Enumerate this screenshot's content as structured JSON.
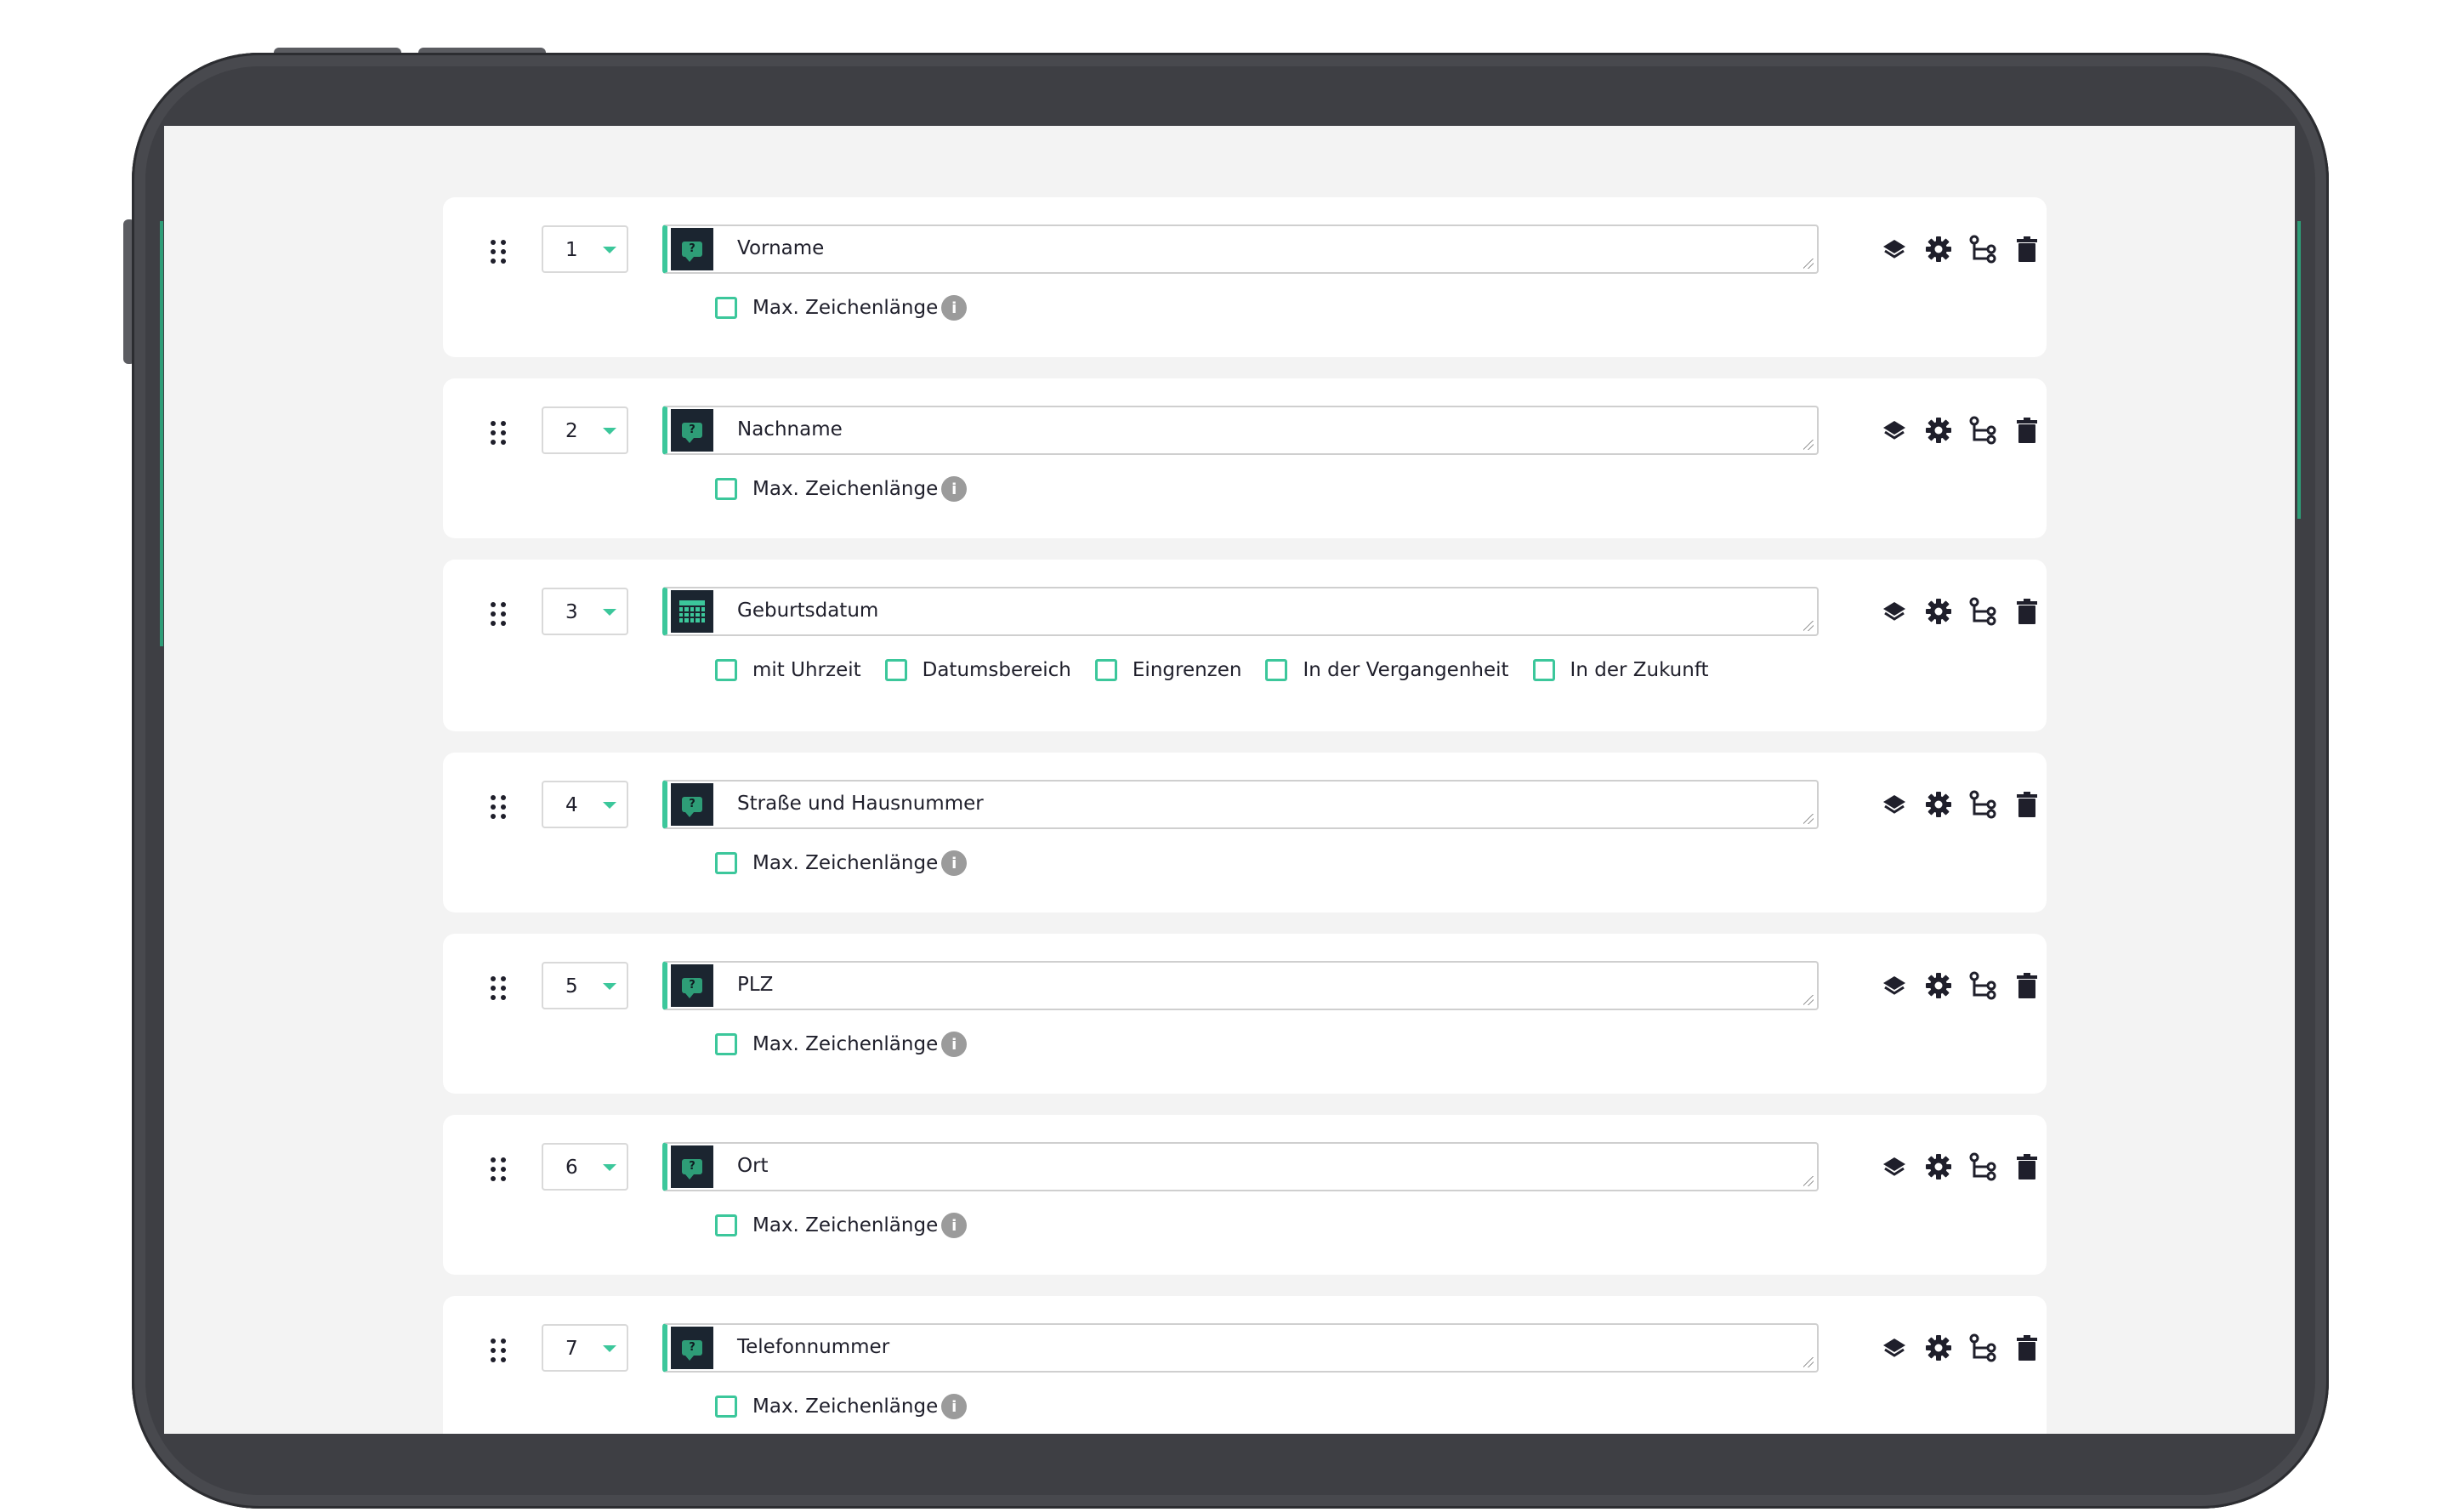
{
  "colors": {
    "accent": "#3cc79b",
    "frame": "#3e3f44",
    "screen": "#f3f3f3",
    "text": "#1f1f2b",
    "icon_bg": "#1b2530"
  },
  "rows": [
    {
      "number": "1",
      "icon": "question-bubble-icon",
      "value": "Vorname",
      "options": [
        {
          "label": "Max. Zeichenlänge",
          "info": "i"
        }
      ]
    },
    {
      "number": "2",
      "icon": "question-bubble-icon",
      "value": "Nachname",
      "options": [
        {
          "label": "Max. Zeichenlänge",
          "info": "i"
        }
      ]
    },
    {
      "number": "3",
      "icon": "calendar-icon",
      "value": "Geburtsdatum",
      "options": [
        {
          "label": "mit Uhrzeit"
        },
        {
          "label": "Datumsbereich"
        },
        {
          "label": "Eingrenzen"
        },
        {
          "label": "In der Vergangenheit"
        },
        {
          "label": "In der Zukunft"
        }
      ]
    },
    {
      "number": "4",
      "icon": "question-bubble-icon",
      "value": "Straße und Hausnummer",
      "options": [
        {
          "label": "Max. Zeichenlänge",
          "info": "i"
        }
      ]
    },
    {
      "number": "5",
      "icon": "question-bubble-icon",
      "value": "PLZ",
      "options": [
        {
          "label": "Max. Zeichenlänge",
          "info": "i"
        }
      ]
    },
    {
      "number": "6",
      "icon": "question-bubble-icon",
      "value": "Ort",
      "options": [
        {
          "label": "Max. Zeichenlänge",
          "info": "i"
        }
      ]
    },
    {
      "number": "7",
      "icon": "question-bubble-icon",
      "value": "Telefonnummer",
      "options": [
        {
          "label": "Max. Zeichenlänge",
          "info": "i"
        }
      ]
    }
  ],
  "row_actions": [
    "layers-icon",
    "gear-icon",
    "logic-branch-icon",
    "trash-icon"
  ]
}
